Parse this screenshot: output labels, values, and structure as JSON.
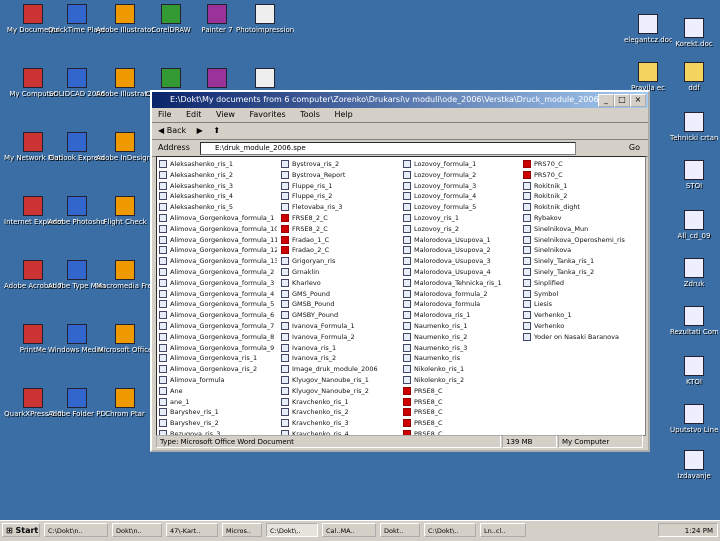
{
  "desktop_icons": [
    {
      "label": "My Documents",
      "icon": "folder-docs-icon"
    },
    {
      "label": "QuickTime Player",
      "icon": "quicktime-icon"
    },
    {
      "label": "Adobe Illustrator 10",
      "icon": "illustrator-icon"
    },
    {
      "label": "CorelDRAW",
      "icon": "corel-icon"
    },
    {
      "label": "Painter 7",
      "icon": "painter-icon"
    },
    {
      "label": "Photoimpression 3",
      "icon": "photoimpression-icon"
    },
    {
      "label": "My Computer",
      "icon": "computer-icon"
    },
    {
      "label": "SOLIDCAD 2006",
      "icon": "cad-icon"
    },
    {
      "label": "Adobe Illustrator CS",
      "icon": "illustrator-cs-icon"
    },
    {
      "label": "CorelDRAW 10",
      "icon": "corel10-icon"
    },
    {
      "label": "FRONT",
      "icon": "front-icon"
    },
    {
      "label": "Nestaf Studenti 4",
      "icon": "nestaf-icon"
    },
    {
      "label": "My Network Places",
      "icon": "network-icon"
    },
    {
      "label": "Outlook Express",
      "icon": "outlook-icon"
    },
    {
      "label": "Adobe InDesign 2.0",
      "icon": "indesign-icon"
    },
    {
      "label": "Recycle Bin",
      "icon": "recycle-bin-icon"
    },
    {
      "label": "Adobe Reader",
      "icon": "reader-icon"
    },
    {
      "label": "Web Image",
      "icon": "web-image-icon"
    },
    {
      "label": "Internet Explorer",
      "icon": "ie-icon"
    },
    {
      "label": "Adobe Photoshop",
      "icon": "photoshop-icon"
    },
    {
      "label": "Flight Check",
      "icon": "flightcheck-icon"
    },
    {
      "label": "Adobe Acrobat 6.0",
      "icon": "acrobat-icon"
    },
    {
      "label": "Attilic Show Tmzl",
      "icon": "attilic-icon"
    },
    {
      "label": "EZ-Poster PLUS 3.0",
      "icon": "poster-icon"
    },
    {
      "label": "Adobe Acrobat 7.0",
      "icon": "acrobat7-icon"
    },
    {
      "label": "Adobe Type Manager",
      "icon": "typemanager-icon"
    },
    {
      "label": "Macromedia FreeHand 10",
      "icon": "freehand-icon"
    },
    {
      "label": "AutoCAD 2002",
      "icon": "autocad-icon"
    },
    {
      "label": "Microsoft Excel",
      "icon": "excel-icon"
    },
    {
      "label": "Snapshot to Windows Clip",
      "icon": "snapshot-icon"
    },
    {
      "label": "PrintMe",
      "icon": "printme-icon"
    },
    {
      "label": "Windows Media Pl.",
      "icon": "mediaplayer-icon"
    },
    {
      "label": "Microsoft Office",
      "icon": "office-icon"
    },
    {
      "label": "Stas Tuppor",
      "icon": "tuppor-icon"
    },
    {
      "label": "CHEMWORKS",
      "icon": "chemworks-icon"
    },
    {
      "label": "Microsoft Word",
      "icon": "word-icon"
    },
    {
      "label": "QuarkXPress 5.0",
      "icon": "quark-icon"
    },
    {
      "label": "Adobe Folder PDF",
      "icon": "adobe-folder-icon"
    },
    {
      "label": "Chrom Ptar",
      "icon": "chrom-icon"
    }
  ],
  "right_icons": [
    {
      "label": "elegantcz.doc",
      "icon": "word-doc-icon"
    },
    {
      "label": "Korekt.doc",
      "icon": "word-doc-icon"
    },
    {
      "label": "Pravila ec",
      "icon": "folder-icon"
    },
    {
      "label": "ddf",
      "icon": "folder-icon"
    },
    {
      "label": "Tehnicki crtanje",
      "icon": "word-doc-icon"
    },
    {
      "label": "STOI",
      "icon": "word-doc-icon"
    },
    {
      "label": "All_cd_09",
      "icon": "word-doc-icon"
    },
    {
      "label": "Zdruk",
      "icon": "word-doc-icon"
    },
    {
      "label": "Rezultati Composta",
      "icon": "word-doc-icon"
    },
    {
      "label": "KTOI",
      "icon": "word-doc-icon"
    },
    {
      "label": "Uputstvo Linenopolje",
      "icon": "word-doc-icon"
    },
    {
      "label": "Izdavanje",
      "icon": "word-doc-icon"
    }
  ],
  "window": {
    "title": "E:\\Dokt\\My documents from 6 computer\\Zorenko\\Drukarsi\\v moduli\\ode_2006\\Verstka\\Druck_module_2006.nj",
    "menu": [
      "File",
      "Edit",
      "View",
      "Favorites",
      "Tools",
      "Help"
    ],
    "back_label": "Back",
    "address_label": "Address",
    "address_value": "E:\\druk_module_2006.spe",
    "go_label": "Go",
    "columns": [
      [
        "Aleksashenko_ris_1",
        "Aleksashenko_ris_2",
        "Aleksashenko_ris_3",
        "Aleksashenko_ris_4",
        "Aleksashenko_ris_5",
        "Alimova_Gorgenkova_formula_1",
        "Alimova_Gorgenkova_formula_10",
        "Alimova_Gorgenkova_formula_11",
        "Alimova_Gorgenkova_formula_12",
        "Alimova_Gorgenkova_formula_13",
        "Alimova_Gorgenkova_formula_2",
        "Alimova_Gorgenkova_formula_3",
        "Alimova_Gorgenkova_formula_4",
        "Alimova_Gorgenkova_formula_5",
        "Alimova_Gorgenkova_formula_6",
        "Alimova_Gorgenkova_formula_7",
        "Alimova_Gorgenkova_formula_8",
        "Alimova_Gorgenkova_formula_9",
        "Alimova_Gorgenkova_ris_1",
        "Alimova_Gorgenkova_ris_2",
        "Alimova_formula",
        "Ane",
        "ane_1",
        "Baryshev_ris_1",
        "Baryshev_ris_2",
        "Bezugova_ris_3"
      ],
      [
        "Bystrova_ris_2",
        "Bystrova_Report",
        "Fluppe_ris_1",
        "Fluppe_ris_2",
        "Fletovaba_ris_3",
        "FRSE8_2_C",
        "FRSE8_2_C",
        "Fradao_1_C",
        "Fradao_2_C",
        "Grigoryan_ris",
        "Grnaklin",
        "Kharlevo",
        "GMS_Pound",
        "GMSB_Pound",
        "GMSBY_Pound",
        "Ivanova_Formula_1",
        "Ivanova_Formula_2",
        "Ivanova_ris_1",
        "Ivanova_ris_2",
        "Image_druk_module_2006",
        "Klyugov_Nanoube_ris_1",
        "Klyugov_Nanoube_ris_2",
        "Kravchenko_ris_1",
        "Kravchenko_ris_2",
        "Kravchenko_ris_3",
        "Kravchenko_ris_4",
        "Kravchenko_ris_5",
        "Kravlyk"
      ],
      [
        "Lozovoy_formula_1",
        "Lozovoy_formula_2",
        "Lozovoy_formula_3",
        "Lozovoy_formula_4",
        "Lozovoy_formula_5",
        "Lozovoy_ris_1",
        "Lozovoy_ris_2",
        "Malorodova_Usupova_1",
        "Malorodova_Usupova_2",
        "Malorodova_Usupova_3",
        "Malorodova_Usupova_4",
        "Malorodova_Tehnicka_ris_1",
        "Malorodova_formula_2",
        "Malorodova_formula",
        "Malorodova_ris_1",
        "Naumenko_ris_1",
        "Naumenko_ris_2",
        "Naumenko_ris_3",
        "Naumenko_ris",
        "Nikolenko_ris_1",
        "Nikolenko_ris_2",
        "PRSE8_C",
        "PRSE8_C",
        "PRSE8_C",
        "PRSE8_C",
        "PRSE8_C"
      ],
      [
        "PRS70_C",
        "PRS70_C",
        "Rokitnik_1",
        "Rokitnik_2",
        "Rokitnik_dight",
        "Rybakov",
        "Sinelnikova_Mun",
        "Sinelnikova_Operoshemi_ris",
        "Sinelnikova",
        "Sinely_Tanka_ris_1",
        "Sinely_Tanka_ris_2",
        "Sinplified",
        "Symbol",
        "Liesis",
        "Verhenko_1",
        "Verhenko",
        "Yoder on Nasaki Baranova"
      ]
    ],
    "status_left": "Type: Microsoft Office Word Document",
    "status_size": "139 MB",
    "status_zone": "My Computer"
  },
  "taskbar": {
    "start_label": "Start",
    "tasks": [
      "C:\\Dokt\\n..",
      "Dokt\\n..",
      "47\\-Kart..",
      "Micros..",
      "C:\\Dokt\\..",
      "Cal..MA..",
      "Dokt..",
      "C:\\Dokt\\..",
      "Ln..cl.."
    ],
    "clock": "1:24 PM"
  },
  "colors": {
    "desktop": "#3a6ea5",
    "titlebar_start": "#0a246a",
    "titlebar_end": "#a6caf0",
    "pdf_red": "#cc0000"
  }
}
